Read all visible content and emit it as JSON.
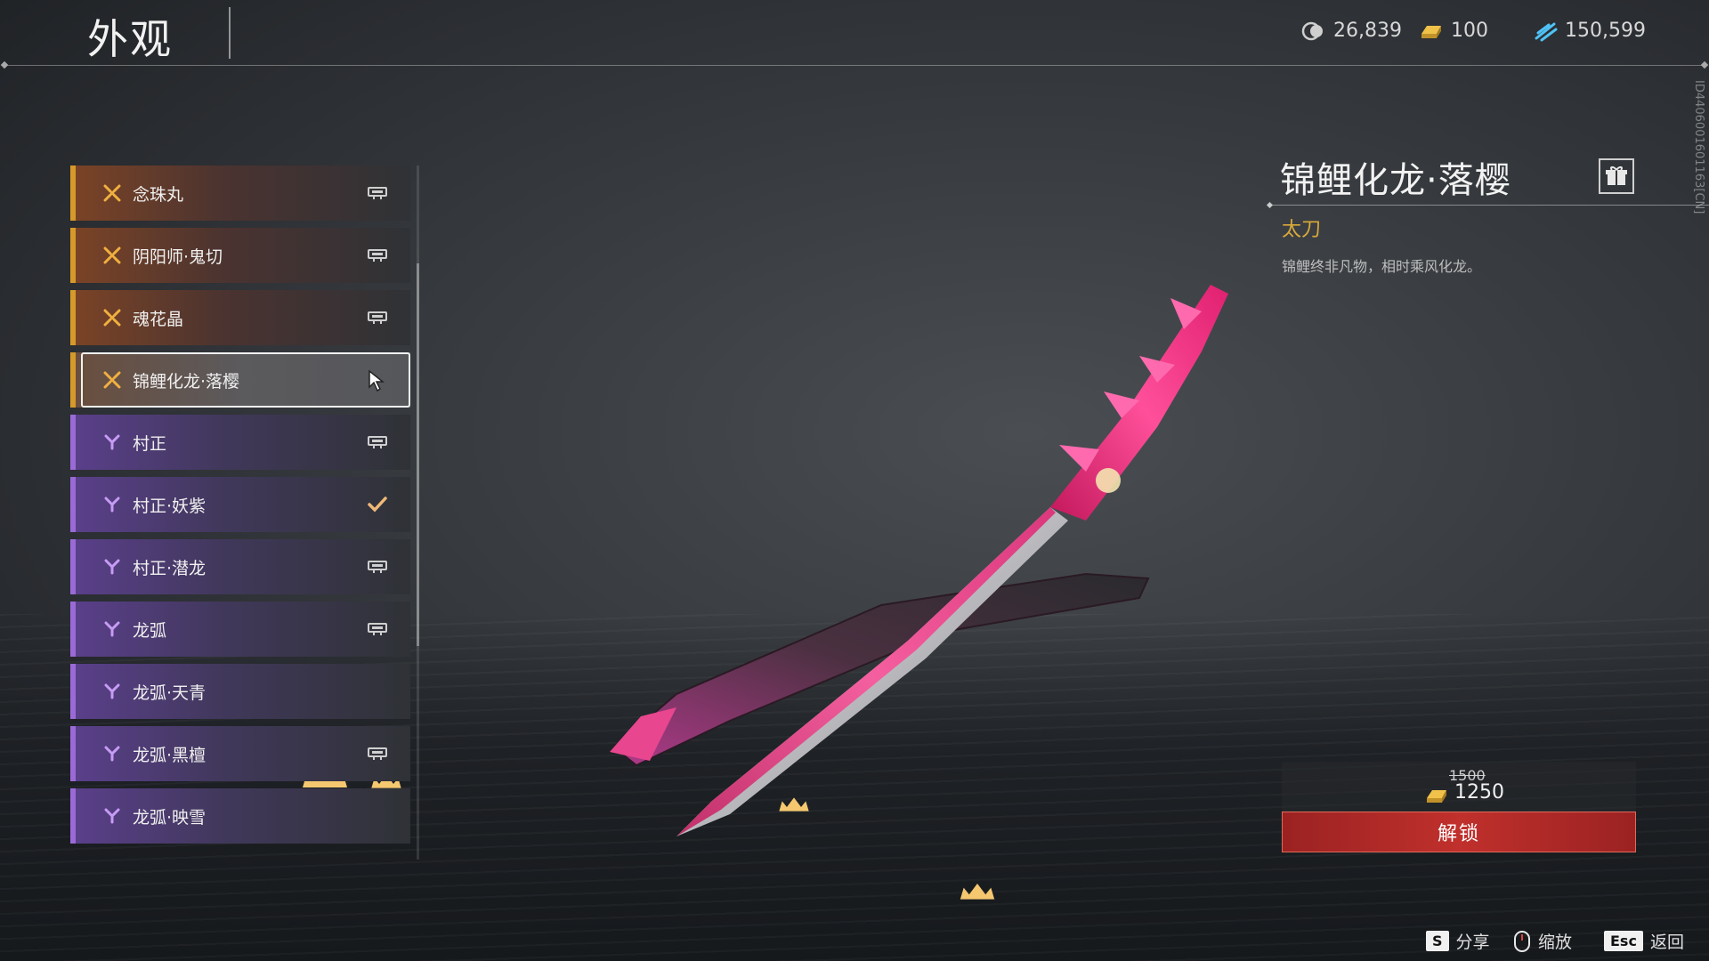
{
  "header": {
    "title": "外观",
    "currencies": [
      {
        "icon": "jade-coin-icon",
        "value": "26,839"
      },
      {
        "icon": "gold-ingot-icon",
        "value": "100"
      },
      {
        "icon": "wind-token-icon",
        "value": "150,599"
      }
    ]
  },
  "list": {
    "items": [
      {
        "label": "念珠丸",
        "rarity": "gold",
        "status": "locked"
      },
      {
        "label": "阴阳师·鬼切",
        "rarity": "gold",
        "status": "locked"
      },
      {
        "label": "魂花晶",
        "rarity": "gold",
        "status": "locked"
      },
      {
        "label": "锦鲤化龙·落樱",
        "rarity": "gold",
        "status": "selected"
      },
      {
        "label": "村正",
        "rarity": "purple",
        "status": "locked"
      },
      {
        "label": "村正·妖紫",
        "rarity": "purple",
        "status": "equipped"
      },
      {
        "label": "村正·潜龙",
        "rarity": "purple",
        "status": "locked"
      },
      {
        "label": "龙弧",
        "rarity": "purple",
        "status": "locked"
      },
      {
        "label": "龙弧·天青",
        "rarity": "purple",
        "status": "none"
      },
      {
        "label": "龙弧·黑檀",
        "rarity": "purple",
        "status": "locked"
      },
      {
        "label": "龙弧·映雪",
        "rarity": "purple",
        "status": "none"
      }
    ]
  },
  "detail": {
    "name": "锦鲤化龙·落樱",
    "type": "太刀",
    "description": "锦鲤终非凡物，相时乘风化龙。",
    "side_id": "ID4406001601163[CN]"
  },
  "purchase": {
    "old_price": "1500",
    "new_price": "1250",
    "unlock_label": "解锁"
  },
  "hints": {
    "share_key": "S",
    "share_label": "分享",
    "zoom_label": "缩放",
    "back_key": "Esc",
    "back_label": "返回"
  },
  "colors": {
    "gold_rarity": "#d69a2a",
    "purple_rarity": "#9a6ad6",
    "unlock_red": "#c0302c",
    "type_gold": "#d9a93a"
  }
}
